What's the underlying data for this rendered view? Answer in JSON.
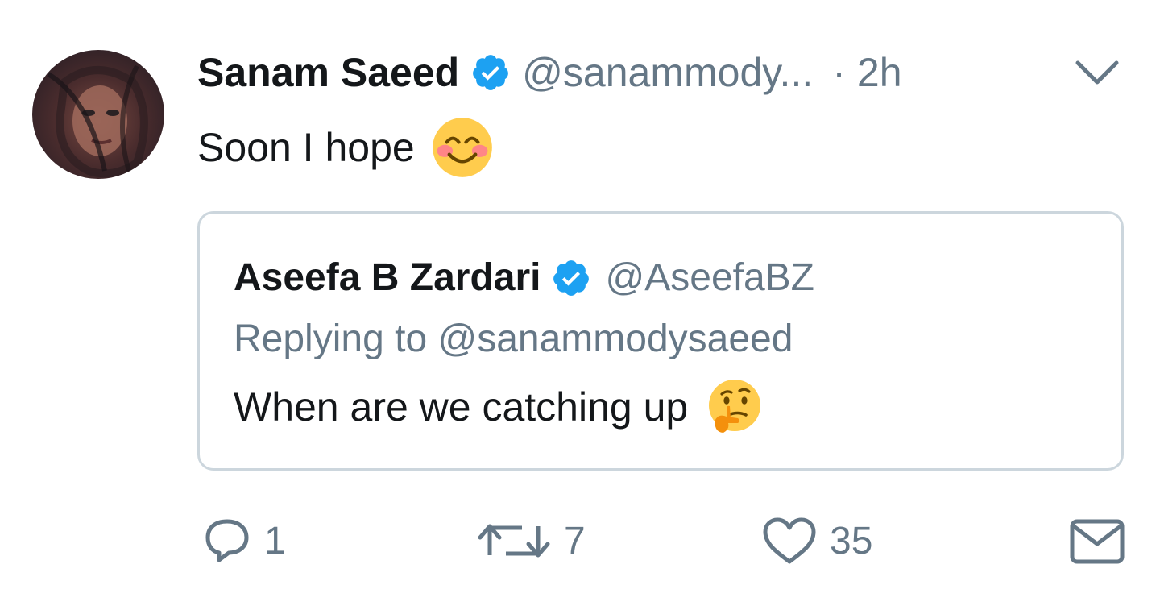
{
  "tweet": {
    "author": {
      "name": "Sanam Saeed",
      "handle": "@sanammody...",
      "verified": true
    },
    "separator": "·",
    "time": "2h",
    "text": "Soon I hope",
    "emoji": "smiling-face-with-smiling-eyes",
    "quoted_tweet": {
      "author": {
        "name": "Aseefa B Zardari",
        "handle": "@AseefaBZ",
        "verified": true
      },
      "replying_to": "Replying to @sanammodysaeed",
      "text": "When are we catching up",
      "emoji": "thinking-face"
    },
    "actions": {
      "reply": {
        "icon": "reply-icon",
        "count": "1"
      },
      "retweet": {
        "icon": "retweet-icon",
        "count": "7"
      },
      "like": {
        "icon": "heart-icon",
        "count": "35"
      },
      "dm": {
        "icon": "envelope-icon"
      }
    }
  },
  "colors": {
    "text_primary": "#14171a",
    "text_secondary": "#657786",
    "verified_blue": "#1da1f2",
    "border": "#ccd6dd",
    "emoji_yellow": "#ffcc4d"
  }
}
